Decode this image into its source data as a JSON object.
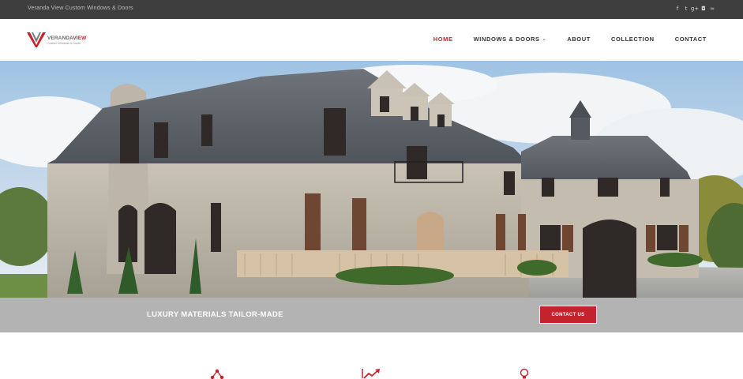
{
  "topbar": {
    "tagline": "Veranda View Custom Windows & Doors",
    "social": [
      {
        "icon": "facebook-icon",
        "glyph": "f"
      },
      {
        "icon": "twitter-icon",
        "glyph": "t"
      },
      {
        "icon": "google-plus-icon",
        "glyph": "g+"
      },
      {
        "icon": "instagram-icon",
        "glyph": "◘"
      },
      {
        "icon": "rss-icon",
        "glyph": "≈"
      }
    ]
  },
  "logo": {
    "word_main": "VERANDA",
    "word_accent": "VIEW",
    "subtitle": "Custom Windows & Doors"
  },
  "nav": {
    "items": [
      {
        "label": "HOME",
        "active": true
      },
      {
        "label": "WINDOWS & DOORS",
        "has_dropdown": true
      },
      {
        "label": "ABOUT"
      },
      {
        "label": "COLLECTION"
      },
      {
        "label": "CONTACT"
      }
    ],
    "dropdown_glyph": "⌄"
  },
  "banner": {
    "text": "LUXURY MATERIALS TAILOR-MADE",
    "button_label": "CONTACT US"
  },
  "colors": {
    "accent": "#c4222d",
    "topbar": "#3e3e3e",
    "banner": "#b3b3b3"
  },
  "features": {
    "icons": [
      "network-icon",
      "growth-chart-icon",
      "lightbulb-icon"
    ]
  }
}
